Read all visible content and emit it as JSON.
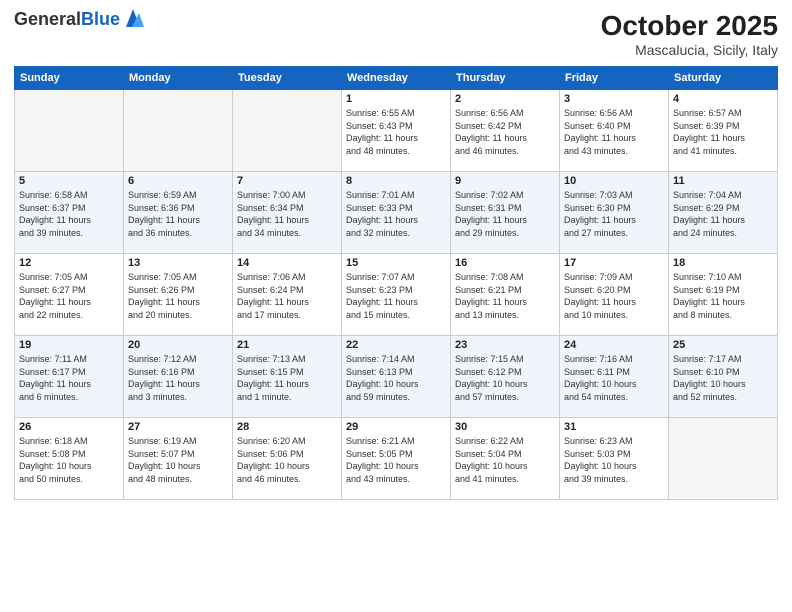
{
  "header": {
    "logo_general": "General",
    "logo_blue": "Blue",
    "month": "October 2025",
    "location": "Mascalucia, Sicily, Italy"
  },
  "weekdays": [
    "Sunday",
    "Monday",
    "Tuesday",
    "Wednesday",
    "Thursday",
    "Friday",
    "Saturday"
  ],
  "rows": [
    [
      {
        "day": "",
        "info": ""
      },
      {
        "day": "",
        "info": ""
      },
      {
        "day": "",
        "info": ""
      },
      {
        "day": "1",
        "info": "Sunrise: 6:55 AM\nSunset: 6:43 PM\nDaylight: 11 hours\nand 48 minutes."
      },
      {
        "day": "2",
        "info": "Sunrise: 6:56 AM\nSunset: 6:42 PM\nDaylight: 11 hours\nand 46 minutes."
      },
      {
        "day": "3",
        "info": "Sunrise: 6:56 AM\nSunset: 6:40 PM\nDaylight: 11 hours\nand 43 minutes."
      },
      {
        "day": "4",
        "info": "Sunrise: 6:57 AM\nSunset: 6:39 PM\nDaylight: 11 hours\nand 41 minutes."
      }
    ],
    [
      {
        "day": "5",
        "info": "Sunrise: 6:58 AM\nSunset: 6:37 PM\nDaylight: 11 hours\nand 39 minutes."
      },
      {
        "day": "6",
        "info": "Sunrise: 6:59 AM\nSunset: 6:36 PM\nDaylight: 11 hours\nand 36 minutes."
      },
      {
        "day": "7",
        "info": "Sunrise: 7:00 AM\nSunset: 6:34 PM\nDaylight: 11 hours\nand 34 minutes."
      },
      {
        "day": "8",
        "info": "Sunrise: 7:01 AM\nSunset: 6:33 PM\nDaylight: 11 hours\nand 32 minutes."
      },
      {
        "day": "9",
        "info": "Sunrise: 7:02 AM\nSunset: 6:31 PM\nDaylight: 11 hours\nand 29 minutes."
      },
      {
        "day": "10",
        "info": "Sunrise: 7:03 AM\nSunset: 6:30 PM\nDaylight: 11 hours\nand 27 minutes."
      },
      {
        "day": "11",
        "info": "Sunrise: 7:04 AM\nSunset: 6:29 PM\nDaylight: 11 hours\nand 24 minutes."
      }
    ],
    [
      {
        "day": "12",
        "info": "Sunrise: 7:05 AM\nSunset: 6:27 PM\nDaylight: 11 hours\nand 22 minutes."
      },
      {
        "day": "13",
        "info": "Sunrise: 7:05 AM\nSunset: 6:26 PM\nDaylight: 11 hours\nand 20 minutes."
      },
      {
        "day": "14",
        "info": "Sunrise: 7:06 AM\nSunset: 6:24 PM\nDaylight: 11 hours\nand 17 minutes."
      },
      {
        "day": "15",
        "info": "Sunrise: 7:07 AM\nSunset: 6:23 PM\nDaylight: 11 hours\nand 15 minutes."
      },
      {
        "day": "16",
        "info": "Sunrise: 7:08 AM\nSunset: 6:21 PM\nDaylight: 11 hours\nand 13 minutes."
      },
      {
        "day": "17",
        "info": "Sunrise: 7:09 AM\nSunset: 6:20 PM\nDaylight: 11 hours\nand 10 minutes."
      },
      {
        "day": "18",
        "info": "Sunrise: 7:10 AM\nSunset: 6:19 PM\nDaylight: 11 hours\nand 8 minutes."
      }
    ],
    [
      {
        "day": "19",
        "info": "Sunrise: 7:11 AM\nSunset: 6:17 PM\nDaylight: 11 hours\nand 6 minutes."
      },
      {
        "day": "20",
        "info": "Sunrise: 7:12 AM\nSunset: 6:16 PM\nDaylight: 11 hours\nand 3 minutes."
      },
      {
        "day": "21",
        "info": "Sunrise: 7:13 AM\nSunset: 6:15 PM\nDaylight: 11 hours\nand 1 minute."
      },
      {
        "day": "22",
        "info": "Sunrise: 7:14 AM\nSunset: 6:13 PM\nDaylight: 10 hours\nand 59 minutes."
      },
      {
        "day": "23",
        "info": "Sunrise: 7:15 AM\nSunset: 6:12 PM\nDaylight: 10 hours\nand 57 minutes."
      },
      {
        "day": "24",
        "info": "Sunrise: 7:16 AM\nSunset: 6:11 PM\nDaylight: 10 hours\nand 54 minutes."
      },
      {
        "day": "25",
        "info": "Sunrise: 7:17 AM\nSunset: 6:10 PM\nDaylight: 10 hours\nand 52 minutes."
      }
    ],
    [
      {
        "day": "26",
        "info": "Sunrise: 6:18 AM\nSunset: 5:08 PM\nDaylight: 10 hours\nand 50 minutes."
      },
      {
        "day": "27",
        "info": "Sunrise: 6:19 AM\nSunset: 5:07 PM\nDaylight: 10 hours\nand 48 minutes."
      },
      {
        "day": "28",
        "info": "Sunrise: 6:20 AM\nSunset: 5:06 PM\nDaylight: 10 hours\nand 46 minutes."
      },
      {
        "day": "29",
        "info": "Sunrise: 6:21 AM\nSunset: 5:05 PM\nDaylight: 10 hours\nand 43 minutes."
      },
      {
        "day": "30",
        "info": "Sunrise: 6:22 AM\nSunset: 5:04 PM\nDaylight: 10 hours\nand 41 minutes."
      },
      {
        "day": "31",
        "info": "Sunrise: 6:23 AM\nSunset: 5:03 PM\nDaylight: 10 hours\nand 39 minutes."
      },
      {
        "day": "",
        "info": ""
      }
    ]
  ]
}
